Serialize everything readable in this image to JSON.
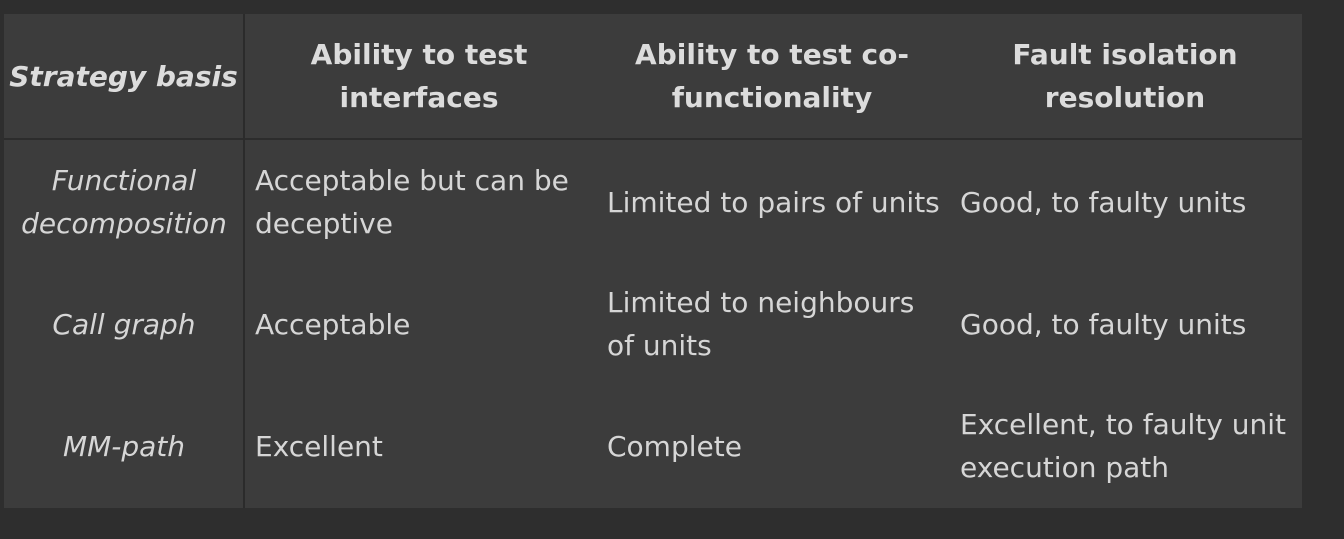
{
  "headers": {
    "col1": "Strategy basis",
    "col2": "Ability to test interfaces",
    "col3": "Ability to test co-functionality",
    "col4": "Fault isolation resolution"
  },
  "rows": [
    {
      "basis": "Functional decomposition",
      "interfaces": "Acceptable but can be deceptive",
      "cofunctionality": "Limited to pairs of units",
      "fault_isolation": "Good, to faulty units"
    },
    {
      "basis": "Call graph",
      "interfaces": "Acceptable",
      "cofunctionality": "Limited to neighbours of units",
      "fault_isolation": "Good, to faulty units"
    },
    {
      "basis": "MM-path",
      "interfaces": "Excellent",
      "cofunctionality": "Complete",
      "fault_isolation": "Excellent, to faulty unit execution path"
    }
  ]
}
